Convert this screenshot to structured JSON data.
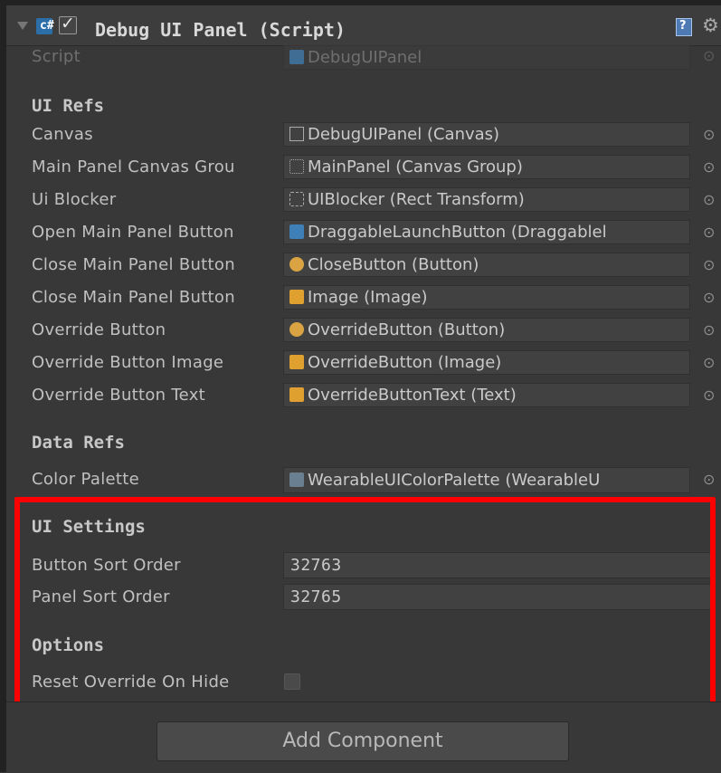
{
  "header": {
    "title": "Debug UI Panel (Script)",
    "script_icon_glyph": "c#",
    "help_glyph": "?",
    "gear_glyph": "⚙"
  },
  "script_row": {
    "label": "Script",
    "value": "DebugUIPanel"
  },
  "sections": {
    "ui_refs": "UI Refs",
    "data_refs": "Data Refs",
    "ui_settings": "UI Settings",
    "options": "Options"
  },
  "ui_refs": [
    {
      "label": "Canvas",
      "value": "DebugUIPanel (Canvas)",
      "icon": "canvas-icon"
    },
    {
      "label": "Main Panel Canvas Grou",
      "value": "MainPanel (Canvas Group)",
      "icon": "canvas-group-icon"
    },
    {
      "label": "Ui Blocker",
      "value": "UIBlocker (Rect Transform)",
      "icon": "rect-transform-icon"
    },
    {
      "label": "Open Main Panel Button",
      "value": "DraggableLaunchButton (Draggablel",
      "icon": "script-icon"
    },
    {
      "label": "Close Main Panel Button",
      "value": "CloseButton (Button)",
      "icon": "button-icon"
    },
    {
      "label": "Close Main Panel Button",
      "value": "Image (Image)",
      "icon": "image-icon"
    },
    {
      "label": "Override Button",
      "value": "OverrideButton (Button)",
      "icon": "button-icon"
    },
    {
      "label": "Override Button Image",
      "value": "OverrideButton (Image)",
      "icon": "image-icon"
    },
    {
      "label": "Override Button Text",
      "value": "OverrideButtonText (Text)",
      "icon": "text-icon"
    }
  ],
  "data_refs": [
    {
      "label": "Color Palette",
      "value": "WearableUIColorPalette (WearableU",
      "icon": "scriptable-object-icon"
    }
  ],
  "ui_settings": {
    "button_sort_order": {
      "label": "Button Sort Order",
      "value": "32763"
    },
    "panel_sort_order": {
      "label": "Panel Sort Order",
      "value": "32765"
    }
  },
  "options": {
    "reset_override_on_hide": {
      "label": "Reset Override On Hide",
      "checked": false
    }
  },
  "picker_glyph": "⊙",
  "add_component_label": "Add Component",
  "colors": {
    "highlight": "#ff0000",
    "background": "#383838"
  }
}
